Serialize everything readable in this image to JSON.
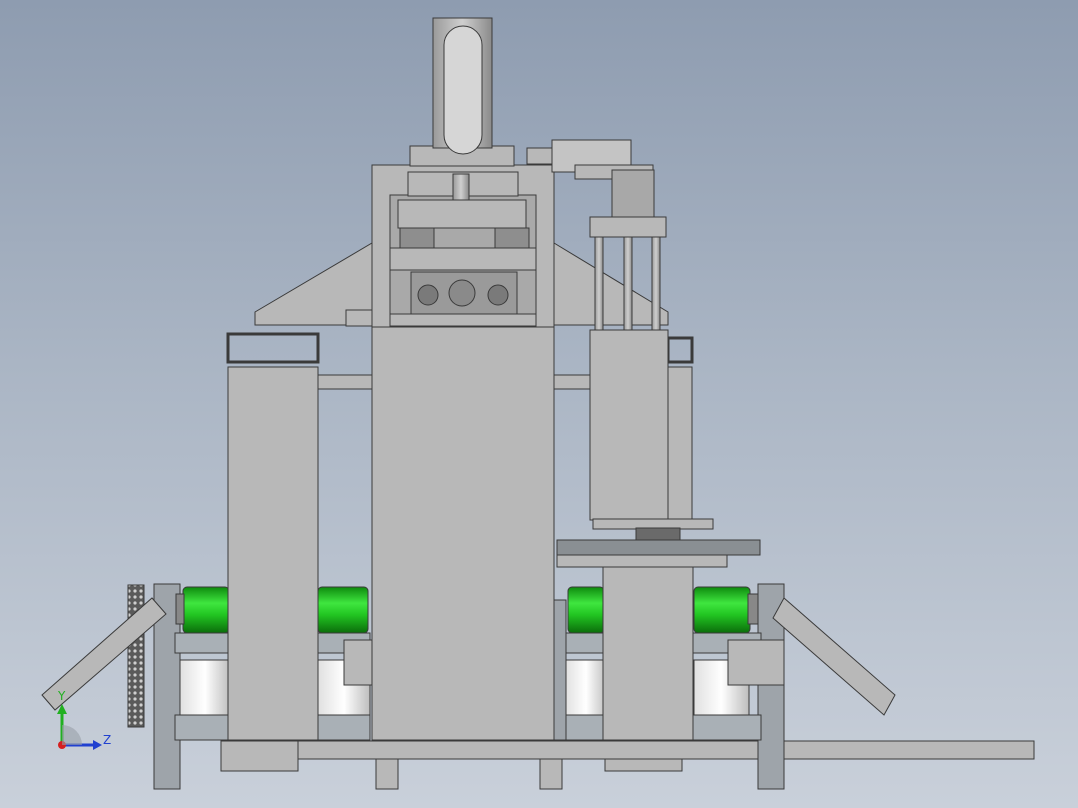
{
  "viewport": {
    "background_top": "#8e9cb0",
    "background_bottom": "#c9d0da"
  },
  "colors": {
    "metal_fill": "#b8b8b8",
    "metal_stroke": "#3a3a3a",
    "roller_green": "#1fc41f",
    "roller_dark": "#0f7f0f",
    "axis_x": "#d42020",
    "axis_y": "#21b021",
    "axis_z": "#2040d0"
  },
  "triad": {
    "y_label": "Y",
    "z_label": "Z"
  }
}
